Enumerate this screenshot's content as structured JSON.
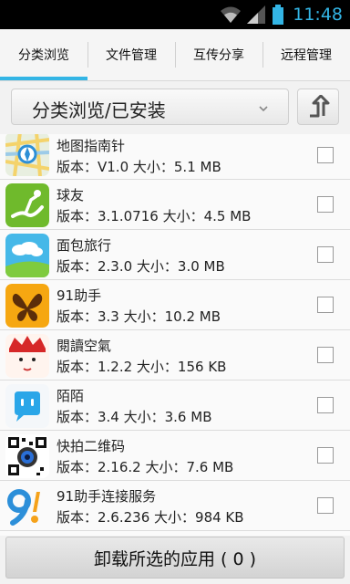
{
  "status_bar": {
    "time": "11:48",
    "icons": [
      "wifi-icon",
      "signal-icon",
      "battery-icon"
    ],
    "clock_color": "#33b5e5"
  },
  "tabs": [
    {
      "label": "分类浏览",
      "active": true
    },
    {
      "label": "文件管理",
      "active": false
    },
    {
      "label": "互传分享",
      "active": false
    },
    {
      "label": "远程管理",
      "active": false
    }
  ],
  "toolbar": {
    "category_select": "分类浏览/已安装",
    "up_button_icon": "up-arrow-icon"
  },
  "apps": [
    {
      "name": "地图指南针",
      "meta": "版本：V1.0 大小：5.1 MB",
      "icon": "map-compass-icon"
    },
    {
      "name": "球友",
      "meta": "版本：3.1.0716 大小：4.5 MB",
      "icon": "golfer-icon"
    },
    {
      "name": "面包旅行",
      "meta": "版本：2.3.0 大小：3.0 MB",
      "icon": "cloud-landscape-icon"
    },
    {
      "name": "91助手",
      "meta": "版本：3.3 大小：10.2 MB",
      "icon": "butterfly-icon"
    },
    {
      "name": "閱讀空氣",
      "meta": "版本：1.2.2 大小：156 KB",
      "icon": "face-icon"
    },
    {
      "name": "陌陌",
      "meta": "版本：3.4 大小：3.6 MB",
      "icon": "chat-bubble-icon"
    },
    {
      "name": "快拍二维码",
      "meta": "版本：2.16.2 大小：7.6 MB",
      "icon": "qr-camera-icon"
    },
    {
      "name": "91助手连接服务",
      "meta": "版本：2.6.236 大小：984 KB",
      "icon": "ninety-one-icon"
    }
  ],
  "uninstall_button": "卸载所选的应用 ( 0 )",
  "colors": {
    "accent": "#33b5e5"
  }
}
